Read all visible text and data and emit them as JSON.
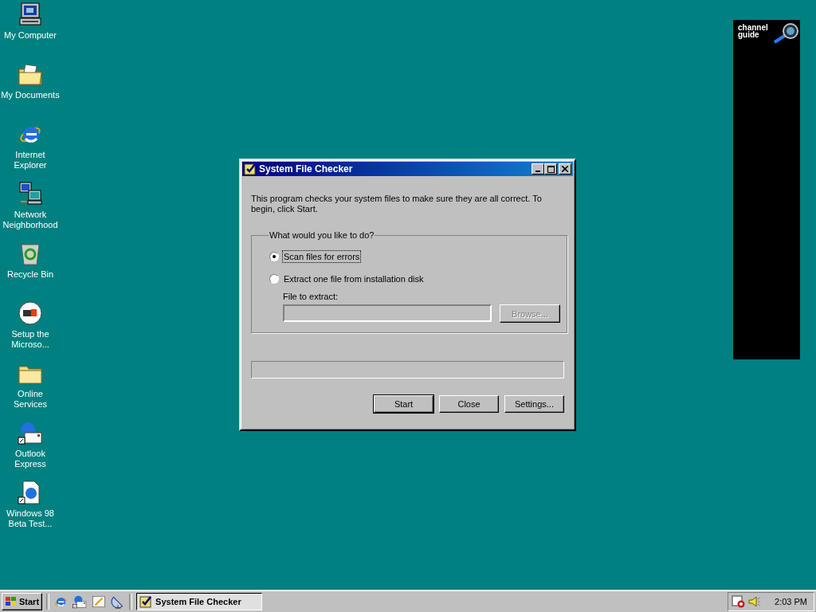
{
  "desktop_icons": [
    {
      "label": "My Computer",
      "kind": "computer"
    },
    {
      "label": "My Documents",
      "kind": "documents"
    },
    {
      "label": "Internet Explorer",
      "kind": "ie"
    },
    {
      "label": "Network Neighborhood",
      "kind": "network"
    },
    {
      "label": "Recycle Bin",
      "kind": "recycle"
    },
    {
      "label": "Setup the Microso...",
      "kind": "msn"
    },
    {
      "label": "Online Services",
      "kind": "folder"
    },
    {
      "label": "Outlook Express",
      "kind": "outlook"
    },
    {
      "label": "Windows 98 Beta Test...",
      "kind": "document"
    }
  ],
  "channel_bar": {
    "lines": [
      "channel",
      "guide"
    ]
  },
  "dialog": {
    "title": "System File Checker",
    "intro": "This program checks your system files to make sure they are all correct. To begin, click Start.",
    "group_label": "What would you like to do?",
    "options": [
      {
        "label": "Scan files for errors",
        "selected": true
      },
      {
        "label": "Extract one file from installation disk",
        "selected": false
      }
    ],
    "file_field": {
      "label": "File to extract:",
      "disabled": true
    },
    "browse_button": {
      "label": "Browse...",
      "disabled": true
    },
    "progress": {
      "level": 0
    },
    "buttons": [
      {
        "label": "Start",
        "default": true
      },
      {
        "label": "Close",
        "default": false
      },
      {
        "label": "Settings...",
        "default": false
      }
    ]
  },
  "taskbar": {
    "start": "Start",
    "quick_launch": [
      {
        "kind": "ie"
      },
      {
        "kind": "outlook"
      },
      {
        "kind": "desktop"
      },
      {
        "kind": "channels"
      }
    ],
    "tasks": [
      {
        "label": "System File Checker",
        "selected": true
      }
    ],
    "clock": "2:03 PM"
  }
}
